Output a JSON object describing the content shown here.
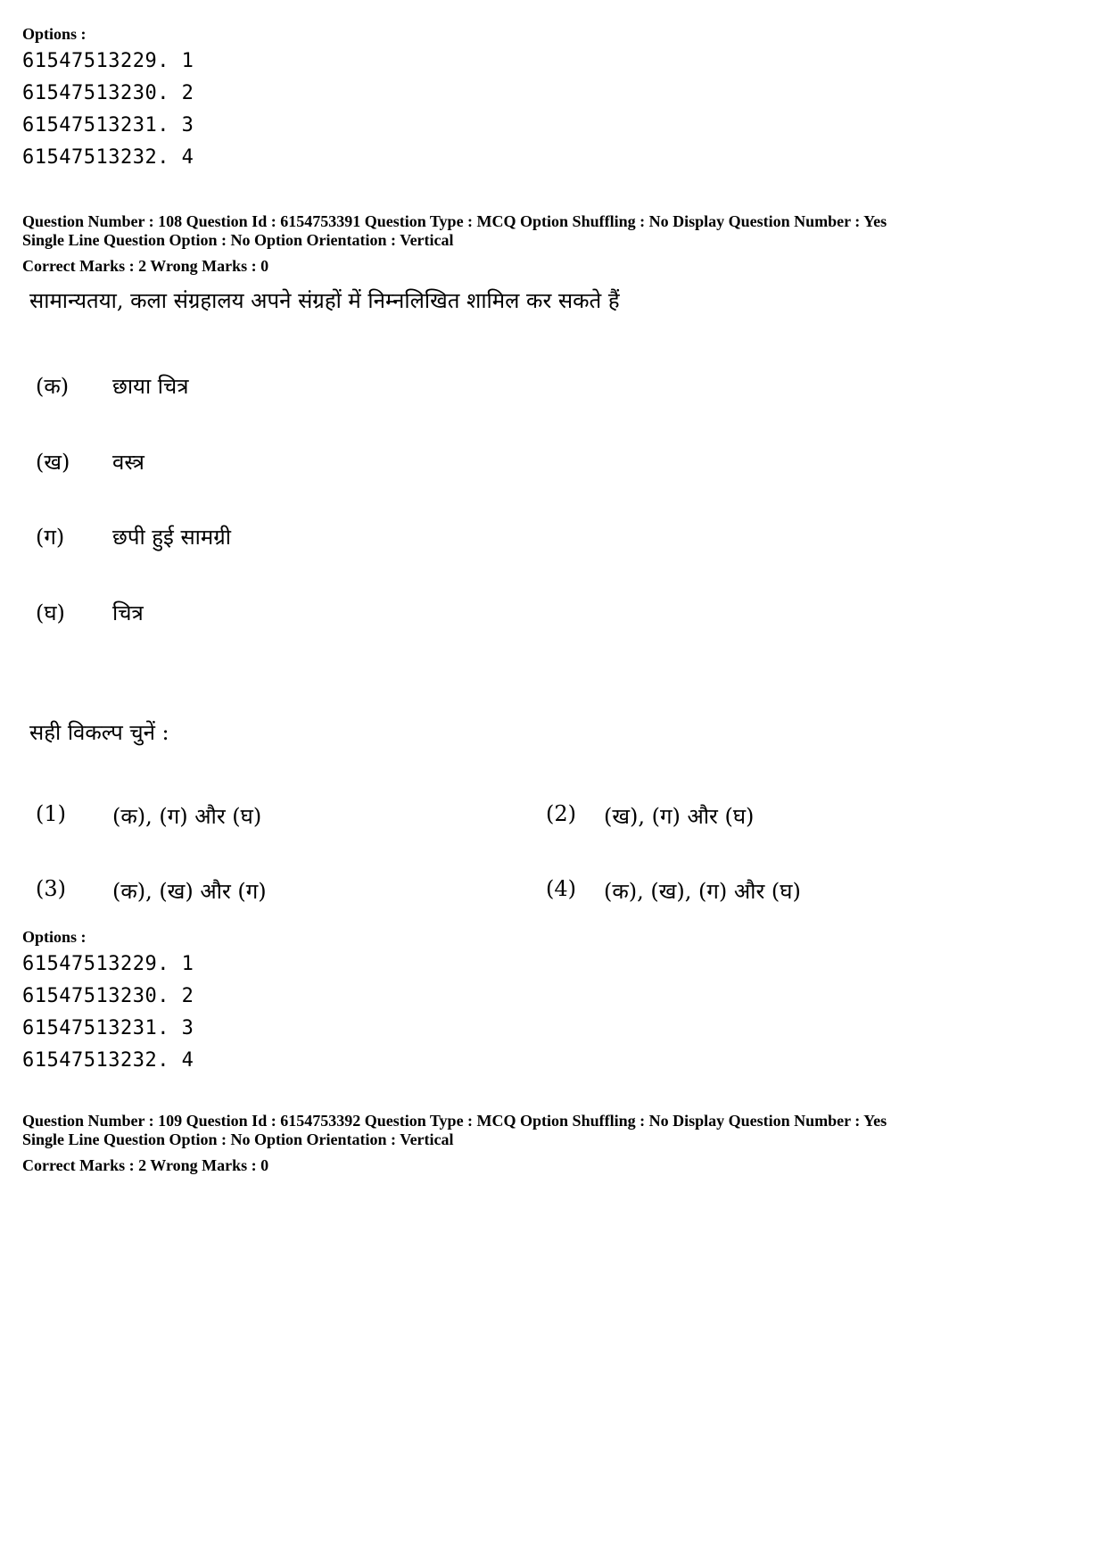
{
  "prev_options": {
    "heading": "Options :",
    "items": [
      "61547513229. 1",
      "61547513230. 2",
      "61547513231. 3",
      "61547513232. 4"
    ]
  },
  "q108": {
    "meta_line1": "Question Number : 108  Question Id : 6154753391  Question Type : MCQ  Option Shuffling : No  Display Question Number : Yes",
    "meta_line2": "Single Line Question Option : No  Option Orientation : Vertical",
    "marks": "Correct Marks : 2  Wrong Marks : 0",
    "stem": "सामान्यतया, कला संग्रहालय अपने संग्रहों में निम्नलिखित शामिल कर सकते हैं",
    "list": [
      {
        "label": "(क)",
        "text": "छाया चित्र"
      },
      {
        "label": "(ख)",
        "text": "वस्त्र"
      },
      {
        "label": "(ग)",
        "text": "छपी हुई सामग्री"
      },
      {
        "label": "(घ)",
        "text": "चित्र"
      }
    ],
    "instruction": "सही विकल्प चुनें :",
    "choices": [
      {
        "num": "(1)",
        "text": "(क), (ग) और (घ)"
      },
      {
        "num": "(2)",
        "text": "(ख), (ग) और (घ)"
      },
      {
        "num": "(3)",
        "text": "(क), (ख) और (ग)"
      },
      {
        "num": "(4)",
        "text": "(क), (ख), (ग) और (घ)"
      }
    ],
    "options_heading": "Options :",
    "options": [
      "61547513229. 1",
      "61547513230. 2",
      "61547513231. 3",
      "61547513232. 4"
    ]
  },
  "q109": {
    "meta_line1": "Question Number : 109  Question Id : 6154753392  Question Type : MCQ  Option Shuffling : No  Display Question Number : Yes",
    "meta_line2": "Single Line Question Option : No  Option Orientation : Vertical",
    "marks": "Correct Marks : 2  Wrong Marks : 0"
  }
}
